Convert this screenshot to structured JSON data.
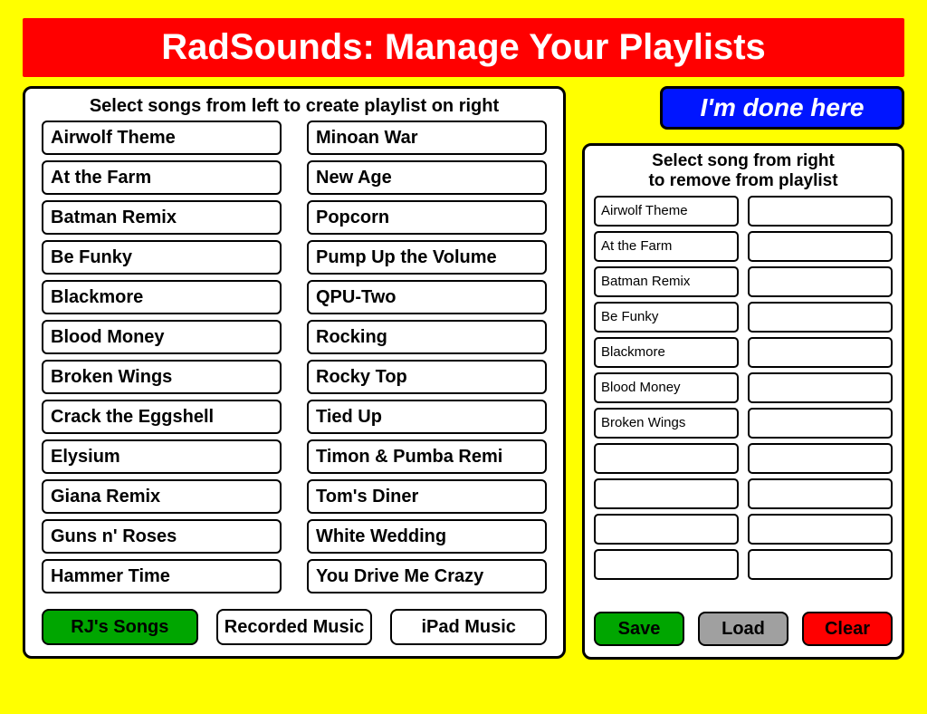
{
  "header": {
    "title": "RadSounds: Manage Your Playlists"
  },
  "left": {
    "instruction": "Select songs from left to create playlist on right",
    "songs_col1": [
      "Airwolf Theme",
      "At the Farm",
      "Batman Remix",
      "Be Funky",
      "Blackmore",
      "Blood Money",
      "Broken Wings",
      "Crack the Eggshell",
      "Elysium",
      "Giana Remix",
      "Guns n' Roses",
      "Hammer Time"
    ],
    "songs_col2": [
      "Minoan War",
      "New Age",
      "Popcorn",
      "Pump Up the Volume",
      "QPU-Two",
      "Rocking",
      "Rocky Top",
      "Tied Up",
      "Timon & Pumba Remi",
      "Tom's Diner",
      "White Wedding",
      "You Drive Me Crazy"
    ],
    "sources": [
      {
        "label": "RJ's Songs",
        "active": true
      },
      {
        "label": "Recorded Music",
        "active": false
      },
      {
        "label": "iPad Music",
        "active": false
      }
    ]
  },
  "done_label": "I'm done here",
  "right": {
    "instruction_line1": "Select song from right",
    "instruction_line2": "to remove from playlist",
    "slots_col1": [
      "Airwolf Theme",
      "At the Farm",
      "Batman Remix",
      "Be Funky",
      "Blackmore",
      "Blood Money",
      "Broken Wings",
      "",
      "",
      "",
      ""
    ],
    "slots_col2": [
      "",
      "",
      "",
      "",
      "",
      "",
      "",
      "",
      "",
      "",
      ""
    ],
    "actions": {
      "save": "Save",
      "load": "Load",
      "clear": "Clear"
    }
  }
}
